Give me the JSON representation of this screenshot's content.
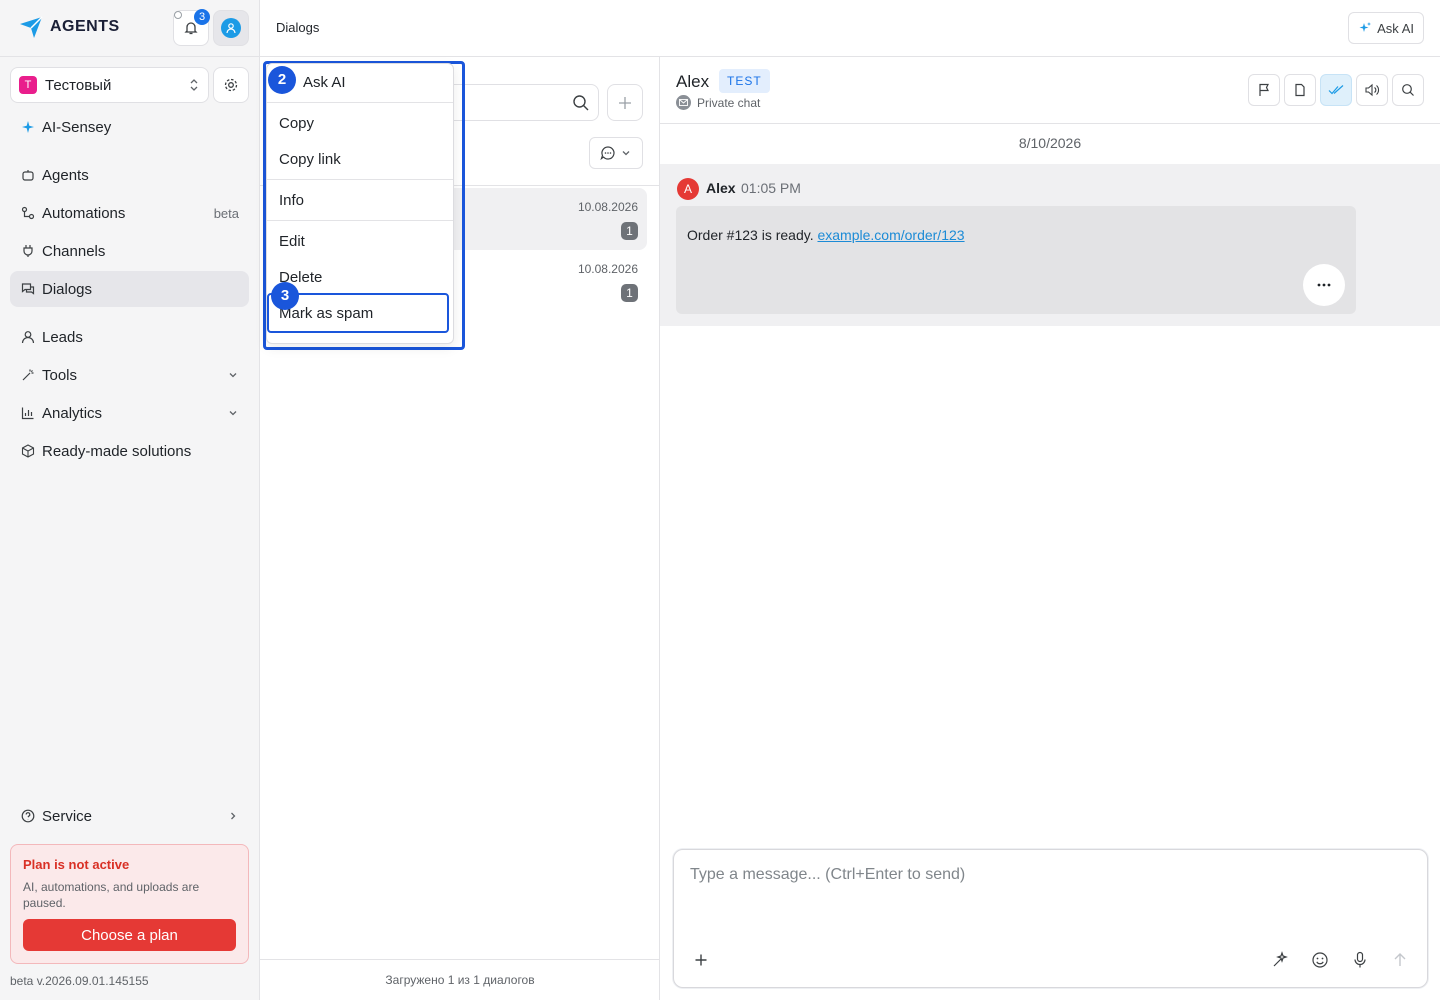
{
  "app": {
    "logo_text": "AGENTS",
    "notifications_count": "3"
  },
  "workspace": {
    "initial": "T",
    "name": "Тестовый"
  },
  "sidebar": {
    "brand_item": "AI-Sensey",
    "items": [
      {
        "label": "Agents"
      },
      {
        "label": "Automations",
        "tag": "beta"
      },
      {
        "label": "Channels"
      },
      {
        "label": "Dialogs"
      },
      {
        "label": "Leads"
      },
      {
        "label": "Tools"
      },
      {
        "label": "Analytics"
      },
      {
        "label": "Ready-made solutions"
      }
    ],
    "service": "Service",
    "plan": {
      "title": "Plan is not active",
      "description": "AI, automations, and uploads are paused.",
      "button": "Choose a plan"
    },
    "version": "beta v.2026.09.01.145155"
  },
  "header": {
    "title": "Dialogs",
    "ask_ai": "Ask AI"
  },
  "dialog_list": {
    "rows": [
      {
        "date": "10.08.2026",
        "unread": "1"
      },
      {
        "date": "10.08.2026",
        "unread": "1"
      }
    ],
    "footer": "Загружено 1 из 1 диалогов"
  },
  "context_menu": {
    "items": [
      "Ask AI",
      "Copy",
      "Copy link",
      "Info",
      "Edit",
      "Delete",
      "Mark as spam"
    ],
    "markers": [
      "2",
      "3"
    ]
  },
  "chat": {
    "name": "Alex",
    "tag": "TEST",
    "subtitle": "Private chat",
    "date": "8/10/2026",
    "message": {
      "avatar_initial": "A",
      "author": "Alex",
      "time": "01:05 PM",
      "text": "Order #123 is ready. ",
      "link": "example.com/order/123"
    },
    "composer_placeholder": "Type a message... (Ctrl+Enter to send)"
  },
  "colors": {
    "accent": "#1a56db",
    "brand": "#1c9be6",
    "danger": "#e53935",
    "workspace_badge": "#e91e8c"
  }
}
